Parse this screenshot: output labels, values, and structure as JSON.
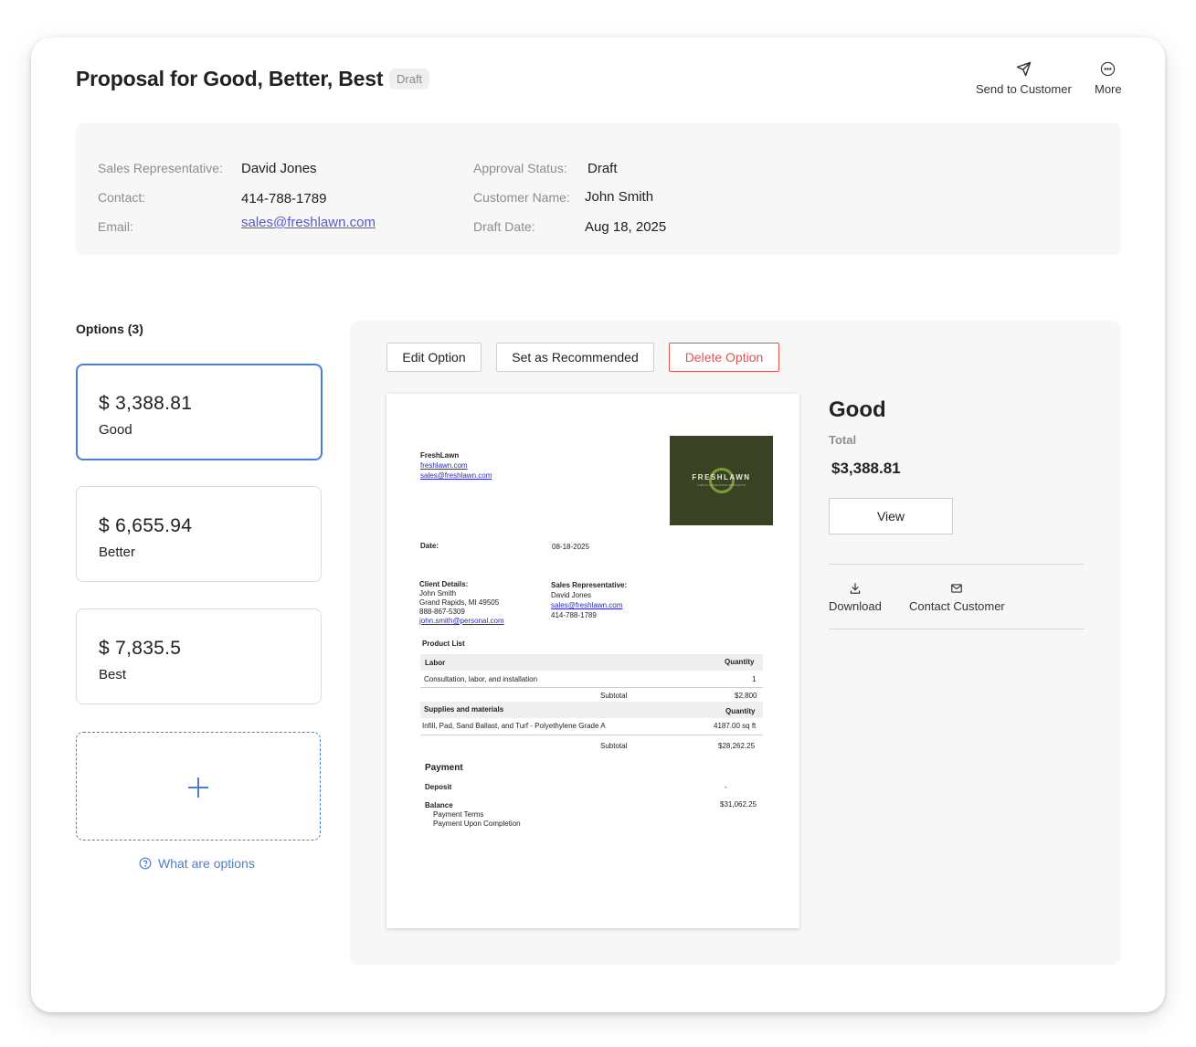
{
  "header": {
    "title": "Proposal for Good, Better, Best",
    "status_badge": "Draft",
    "send_label": "Send to Customer",
    "more_label": "More"
  },
  "info": {
    "sales_rep_label": "Sales Representative:",
    "sales_rep": "David Jones",
    "contact_label": "Contact:",
    "contact": "414-788-1789",
    "email_label": "Email:",
    "email": "sales@freshlawn.com",
    "approval_label": "Approval Status:",
    "approval": "Draft",
    "customer_label": "Customer Name:",
    "customer": "John Smith",
    "draft_date_label": "Draft Date:",
    "draft_date": "Aug 18, 2025"
  },
  "options": {
    "title": "Options (3)",
    "items": [
      {
        "price": "$ 3,388.81",
        "name": "Good"
      },
      {
        "price": "$ 6,655.94",
        "name": "Better"
      },
      {
        "price": "$ 7,835.5",
        "name": "Best"
      }
    ],
    "help_link": "What are options"
  },
  "toolbar": {
    "edit": "Edit Option",
    "recommend": "Set as Recommended",
    "delete": "Delete Option"
  },
  "document": {
    "company": "FreshLawn",
    "website": "freshlawn.com",
    "email": "sales@freshlawn.com",
    "logo_text": "FRESHLAWN",
    "logo_sub": "TURF & LANDSCAPING SPECIALISTS",
    "date_label": "Date:",
    "date": "08-18-2025",
    "client_label": "Client Details:",
    "client_name": "John Smith",
    "client_address": "Grand Rapids, MI 49505",
    "client_phone": "888-867-5309",
    "client_email": "john.smith@personal.com",
    "rep_label": "Sales Representative:",
    "rep_name": "David Jones",
    "rep_email": "sales@freshlawn.com",
    "rep_phone": "414-788-1789",
    "product_list": "Product List",
    "labor": "Labor",
    "quantity": "Quantity",
    "labor_item": "Consultation, labor, and installation",
    "labor_qty": "1",
    "subtotal": "Subtotal",
    "labor_subtotal": "$2,800",
    "supplies": "Supplies and materials",
    "supplies_item": "Infill, Pad, Sand Ballast, and Turf - Polyethylene Grade A",
    "supplies_qty": "4187.00 sq ft",
    "supplies_subtotal": "$28,262.25",
    "payment": "Payment",
    "deposit": "Deposit",
    "deposit_val": "-",
    "balance": "Balance",
    "balance_val": "$31,062.25",
    "payment_terms": "Payment Terms",
    "payment_upon": "Payment Upon Completion"
  },
  "detail": {
    "name": "Good",
    "total_label": "Total",
    "total": "$3,388.81",
    "view": "View",
    "download": "Download",
    "contact": "Contact Customer"
  },
  "colors": {
    "accent": "#4a7fd4",
    "danger": "#e05252",
    "link": "#5b57d1",
    "logo_bg": "#394323"
  }
}
